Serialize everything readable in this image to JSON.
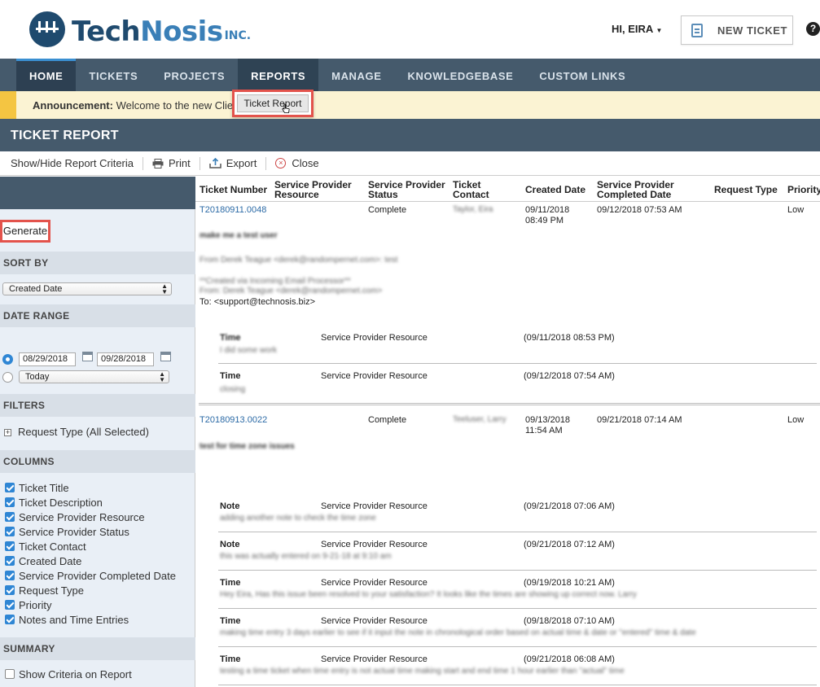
{
  "header": {
    "logo_main": "Tech",
    "logo_accent": "Nosis",
    "logo_suffix": "INC.",
    "user_greeting": "HI, EIRA",
    "new_ticket_label": "NEW TICKET",
    "help_glyph": "?"
  },
  "nav": {
    "items": [
      "HOME",
      "TICKETS",
      "PROJECTS",
      "REPORTS",
      "MANAGE",
      "KNOWLEDGEBASE",
      "CUSTOM LINKS"
    ],
    "active": "HOME"
  },
  "dropdown": {
    "item": "Ticket Report"
  },
  "announcement": {
    "label": "Announcement:",
    "text": "Welcome to the new Client"
  },
  "page_title": "TICKET REPORT",
  "toolbar": {
    "show_hide": "Show/Hide Report Criteria",
    "print": "Print",
    "export": "Export",
    "close": "Close"
  },
  "sidebar": {
    "generate_label": "Generate",
    "sort_by": {
      "heading": "SORT BY",
      "value": "Created Date"
    },
    "date_range": {
      "heading": "DATE RANGE",
      "from": "08/29/2018",
      "to": "09/28/2018",
      "preset": "Today"
    },
    "filters": {
      "heading": "FILTERS",
      "item": "Request Type (All Selected)"
    },
    "columns": {
      "heading": "COLUMNS",
      "items": [
        "Ticket Title",
        "Ticket Description",
        "Service Provider Resource",
        "Service Provider Status",
        "Ticket Contact",
        "Created Date",
        "Service Provider Completed Date",
        "Request Type",
        "Priority",
        "Notes and Time Entries"
      ]
    },
    "summary": {
      "heading": "SUMMARY",
      "item": "Show Criteria on Report"
    }
  },
  "report": {
    "columns": [
      "Ticket Number",
      "Service Provider Resource",
      "Service Provider Status",
      "Ticket Contact",
      "Created Date",
      "Service Provider Completed Date",
      "Request Type",
      "Priority"
    ],
    "tickets": [
      {
        "number": "T20180911.0048",
        "status": "Complete",
        "contact": "Taylor, Eira",
        "created": "09/11/2018 08:49 PM",
        "created_line1": "09/11/2018",
        "created_line2": "08:49 PM",
        "completed": "09/12/2018 07:53 AM",
        "priority": "Low",
        "title": "make me a test user",
        "desc_line1": "From Derek Teague <derek@randompernet.com>: test",
        "desc_line2": "**Created via Incoming Email Processor**",
        "desc_line3": "From: Derek Teague <derek@randompernet.com>",
        "desc_line4": "To: <support@technosis.biz>",
        "entries": [
          {
            "type": "Time",
            "resource": "Service Provider Resource",
            "date": "(09/11/2018 08:53 PM)",
            "note": "I did some work"
          },
          {
            "type": "Time",
            "resource": "Service Provider Resource",
            "date": "(09/12/2018 07:54 AM)",
            "note": "closing"
          }
        ]
      },
      {
        "number": "T20180913.0022",
        "status": "Complete",
        "contact": "Teeluser, Larry",
        "created": "09/13/2018 11:54 AM",
        "created_line1": "09/13/2018",
        "created_line2": "11:54 AM",
        "completed": "09/21/2018 07:14 AM",
        "priority": "Low",
        "title": "test for time zone issues",
        "entries": [
          {
            "type": "Note",
            "resource": "Service Provider Resource",
            "date": "(09/21/2018 07:06 AM)",
            "note": "adding another note to check the time zone"
          },
          {
            "type": "Note",
            "resource": "Service Provider Resource",
            "date": "(09/21/2018 07:12 AM)",
            "note": "this was actually entered on 9-21-18 at 9:10 am"
          },
          {
            "type": "Time",
            "resource": "Service Provider Resource",
            "date": "(09/19/2018 10:21 AM)",
            "note": "Hey Eira, Has this issue been resolved to your satisfaction? It looks like the times are showing up correct now. Larry"
          },
          {
            "type": "Time",
            "resource": "Service Provider Resource",
            "date": "(09/18/2018 07:10 AM)",
            "note": "making time entry 3 days earlier to see if it input the note in chronological order based on actual time & date or \"entered\" time & date"
          },
          {
            "type": "Time",
            "resource": "Service Provider Resource",
            "date": "(09/21/2018 06:08 AM)",
            "note": "testing a time ticket when time entry is not actual time making start and end time 1 hour earlier than \"actual\" time"
          }
        ]
      }
    ]
  },
  "colors": {
    "nav_bg": "#455a6c",
    "accent": "#3a8fd1",
    "highlight": "#e3534c",
    "announcement_bg": "#fbf3d3",
    "link": "#2b6aa6"
  }
}
